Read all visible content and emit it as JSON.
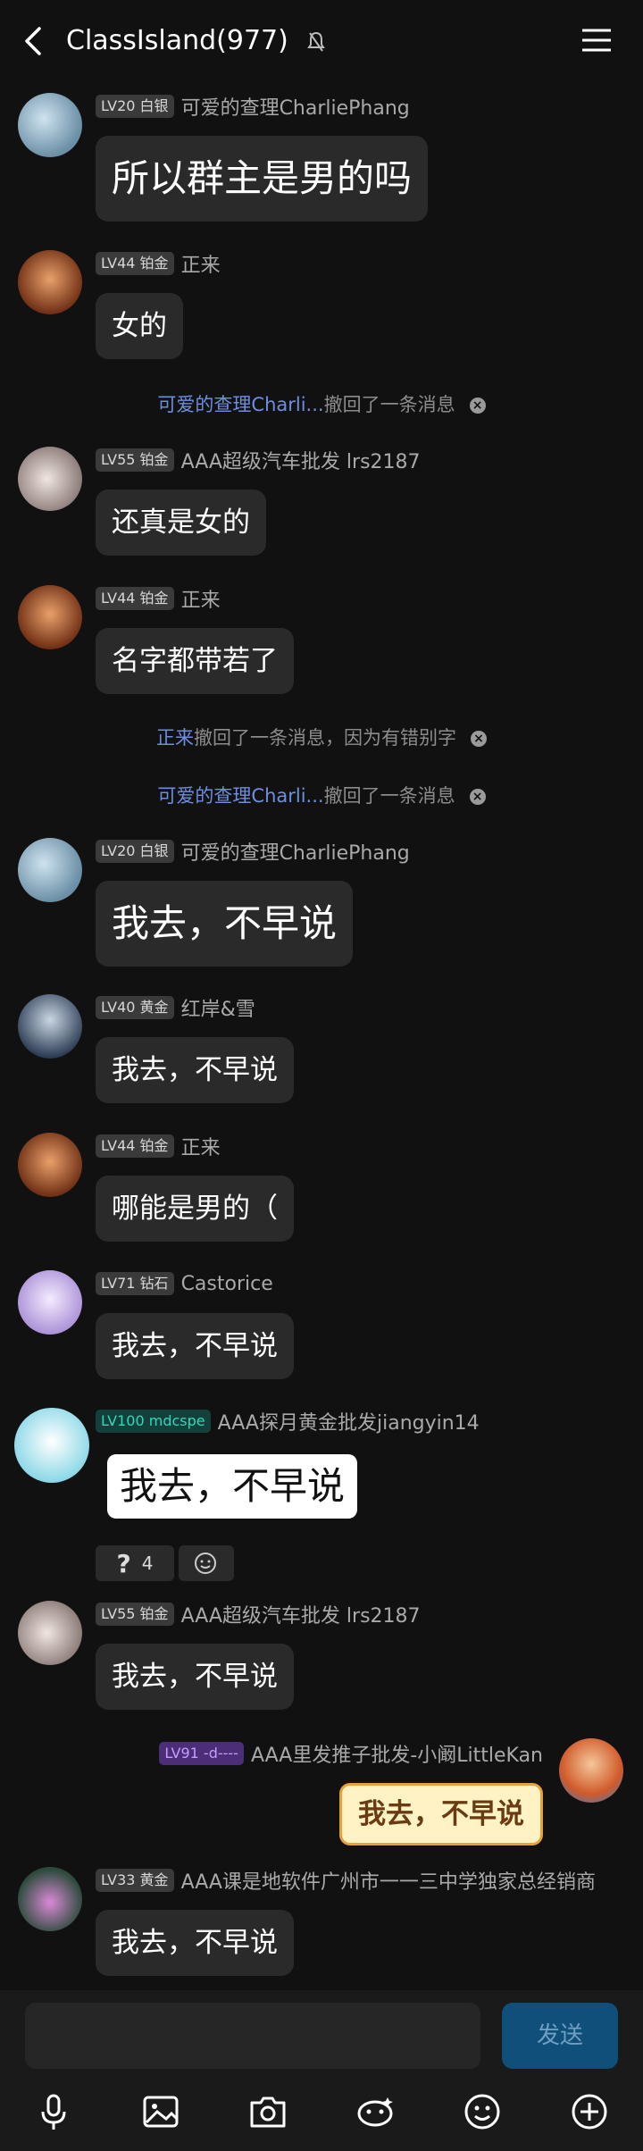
{
  "header": {
    "title": "ClassIsland(977)"
  },
  "messages": [
    {
      "level": "LV20 白银",
      "nick": "可爱的查理CharliePhang",
      "text": "所以群主是男的吗"
    },
    {
      "level": "LV44 铂金",
      "nick": "正来",
      "text": "女的"
    },
    {
      "level": "LV55 铂金",
      "nick": "AAA超级汽车批发 lrs2187",
      "text": "还真是女的"
    },
    {
      "level": "LV44 铂金",
      "nick": "正来",
      "text": "名字都带若了"
    },
    {
      "level": "LV20 白银",
      "nick": "可爱的查理CharliePhang",
      "text": "我去，不早说"
    },
    {
      "level": "LV40 黄金",
      "nick": "红岸&雪",
      "text": "我去，不早说"
    },
    {
      "level": "LV44 铂金",
      "nick": "正来",
      "text": "哪能是男的（"
    },
    {
      "level": "LV71 钻石",
      "nick": "Castorice",
      "text": "我去，不早说"
    },
    {
      "level": "LV100 mdcspe",
      "nick": "AAA探月黄金批发jiangyin14",
      "text": "我去，不早说"
    },
    {
      "level": "LV55 铂金",
      "nick": "AAA超级汽车批发 lrs2187",
      "text": "我去，不早说"
    },
    {
      "level": "LV91 -d----",
      "nick": "AAA里发推子批发-小阚LittleKan",
      "text": "我去，不早说"
    },
    {
      "level": "LV33 黄金",
      "nick": "AAA课是地软件广州市一一三中学独家总经销商",
      "text": "我去，不早说"
    }
  ],
  "notices": [
    {
      "who": "可爱的查理Charli...",
      "text": "撤回了一条消息"
    },
    {
      "who": "正来",
      "text": "撤回了一条消息，因为有错别字"
    },
    {
      "who": "可爱的查理Charli...",
      "text": "撤回了一条消息"
    }
  ],
  "reactions": {
    "question_count": "4"
  },
  "input": {
    "send_label": "发送"
  },
  "colors": {
    "background": "#111111",
    "bubble": "#2a2a2a",
    "send": "#0f4f7a",
    "notice_name": "#6c8fe0"
  },
  "icons": [
    "back-arrow-icon",
    "mute-icon",
    "menu-icon",
    "mic-icon",
    "image-icon",
    "camera-icon",
    "sticker-icon",
    "emoji-icon",
    "plus-icon"
  ]
}
